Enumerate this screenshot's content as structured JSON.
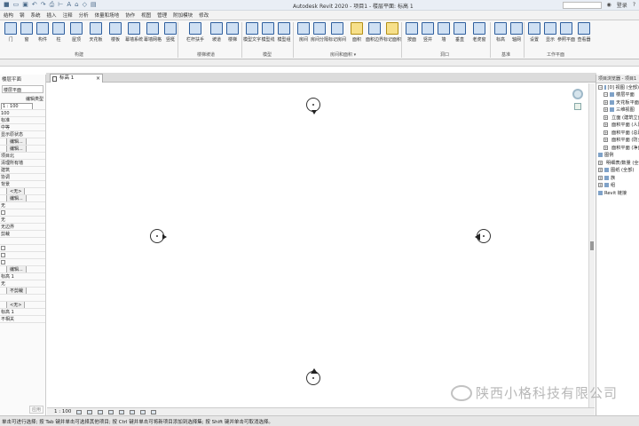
{
  "titlebar": {
    "title": "Autodesk Revit 2020 - 项目1 - 楼层平面: 标高 1",
    "user": "登录",
    "help": "?"
  },
  "menu": [
    "结构",
    "钢",
    "系统",
    "插入",
    "注释",
    "分析",
    "体量和场地",
    "协作",
    "视图",
    "管理",
    "附加模块",
    "修改"
  ],
  "ribbon": {
    "buttons": [
      {
        "label": "门"
      },
      {
        "label": "窗"
      },
      {
        "label": "构件"
      },
      {
        "label": "柱"
      },
      {
        "label": "屋顶"
      },
      {
        "label": "天花板"
      },
      {
        "label": "楼板"
      },
      {
        "label": "幕墙系统"
      },
      {
        "label": "幕墙网格"
      },
      {
        "label": "竖梃"
      },
      {
        "label": "栏杆扶手"
      },
      {
        "label": "坡道"
      },
      {
        "label": "楼梯"
      },
      {
        "label": "模型文字"
      },
      {
        "label": "模型线"
      },
      {
        "label": "模型组"
      },
      {
        "label": "房间"
      },
      {
        "label": "房间分隔"
      },
      {
        "label": "标记房间"
      },
      {
        "label": "面积"
      },
      {
        "label": "面积边界"
      },
      {
        "label": "标记面积"
      },
      {
        "label": "按面"
      },
      {
        "label": "竖井"
      },
      {
        "label": "墙"
      },
      {
        "label": "垂直"
      },
      {
        "label": "老虎窗"
      },
      {
        "label": "标高"
      },
      {
        "label": "轴网"
      },
      {
        "label": "设置"
      },
      {
        "label": "显示"
      },
      {
        "label": "参照平面"
      },
      {
        "label": "查看器"
      }
    ],
    "panels": [
      "构建",
      "楼梯坡道",
      "模型",
      "房间和面积 ▾",
      "洞口",
      "基准",
      "工作平面"
    ]
  },
  "properties": {
    "header": "楼层平面",
    "type_selector": "楼层平面",
    "edit_type": "编辑类型",
    "rows": [
      {
        "kind": "input",
        "text": "1 : 100"
      },
      {
        "kind": "text",
        "text": "100"
      },
      {
        "kind": "text",
        "text": "标准"
      },
      {
        "kind": "text",
        "text": "中等"
      },
      {
        "kind": "text",
        "text": "显示原状态"
      },
      {
        "kind": "btn",
        "text": "编辑..."
      },
      {
        "kind": "btn",
        "text": "编辑..."
      },
      {
        "kind": "text",
        "text": "项目北"
      },
      {
        "kind": "text",
        "text": "清理所有墙"
      },
      {
        "kind": "text",
        "text": "建筑"
      },
      {
        "kind": "text",
        "text": "协调"
      },
      {
        "kind": "text",
        "text": "背景"
      },
      {
        "kind": "btn",
        "text": "<无>"
      },
      {
        "kind": "btn",
        "text": "编辑..."
      },
      {
        "kind": "text",
        "text": "无"
      },
      {
        "kind": "check",
        "text": ""
      },
      {
        "kind": "text",
        "text": "无"
      },
      {
        "kind": "text",
        "text": "无边界"
      },
      {
        "kind": "text",
        "text": "剪裁"
      },
      {
        "kind": "text",
        "text": ""
      },
      {
        "kind": "check",
        "text": ""
      },
      {
        "kind": "check",
        "text": ""
      },
      {
        "kind": "check",
        "text": ""
      },
      {
        "kind": "btn",
        "text": "编辑..."
      },
      {
        "kind": "text",
        "text": "标高 1"
      },
      {
        "kind": "text",
        "text": "无"
      },
      {
        "kind": "btn",
        "text": "不剪裁"
      },
      {
        "kind": "text",
        "text": ""
      },
      {
        "kind": "btn",
        "text": "<无>"
      },
      {
        "kind": "text",
        "text": "标高 1"
      },
      {
        "kind": "text",
        "text": "不相关"
      }
    ],
    "apply": "应用"
  },
  "view_tab": {
    "label": "标高 1",
    "close": "×"
  },
  "project_browser": {
    "header": "项目浏览器 - 项目1",
    "nodes": [
      {
        "exp": "−",
        "label": "[0] 视图 (全部)",
        "level": 0
      },
      {
        "exp": "−",
        "label": "楼层平面",
        "level": 1
      },
      {
        "exp": "+",
        "label": "天花板平面",
        "level": 1
      },
      {
        "exp": "+",
        "label": "三维视图",
        "level": 1
      },
      {
        "exp": "+",
        "label": "立面 (建筑立面)",
        "level": 1
      },
      {
        "exp": "+",
        "label": "面积平面 (人防分区面积)",
        "level": 1
      },
      {
        "exp": "+",
        "label": "面积平面 (总建筑面积)",
        "level": 1
      },
      {
        "exp": "+",
        "label": "面积平面 (防火分区面积)",
        "level": 1
      },
      {
        "exp": "+",
        "label": "面积平面 (净面积)",
        "level": 1
      },
      {
        "exp": "",
        "label": "图例",
        "level": 0
      },
      {
        "exp": "+",
        "label": "明细表/数量 (全部)",
        "level": 0
      },
      {
        "exp": "+",
        "label": "图纸 (全部)",
        "level": 0
      },
      {
        "exp": "+",
        "label": "族",
        "level": 0
      },
      {
        "exp": "+",
        "label": "组",
        "level": 0
      },
      {
        "exp": "",
        "label": "Revit 链接",
        "level": 0
      }
    ]
  },
  "view_control": {
    "scale": "1 : 100"
  },
  "status": {
    "text": "单击可进行选择; 按 Tab 键并单击可选择其他项目; 按 Ctrl 键并单击可将新项目添加到选择集; 按 Shift 键并单击可取消选择。"
  },
  "watermark": {
    "text": "陕西小格科技有限公司"
  },
  "colors": {
    "accent": "#2f5f9e",
    "ribbon_bg": "#f7f7f7"
  }
}
